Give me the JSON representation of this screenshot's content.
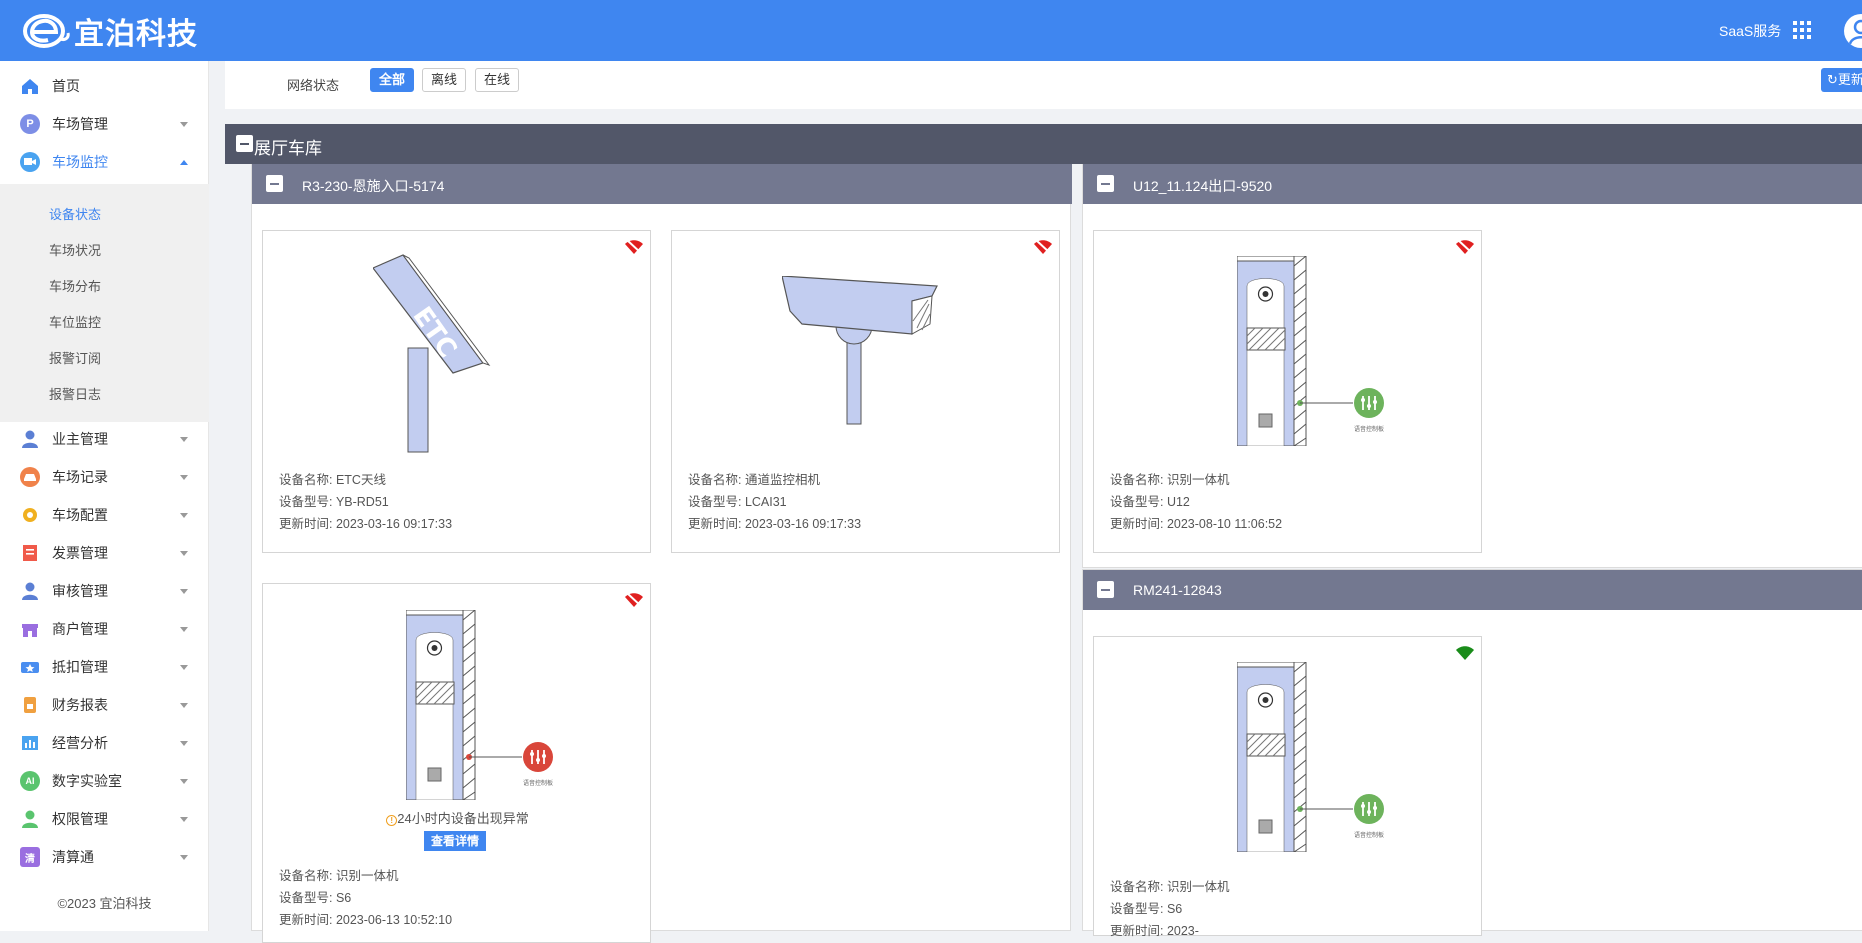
{
  "app": {
    "brand": "宜泊科技",
    "saas_label": "SaaS服务",
    "copyright": "©2023 宜泊科技"
  },
  "sidebar": {
    "items": [
      {
        "label": "首页",
        "icon": "home-icon",
        "color": "#3f86f0"
      },
      {
        "label": "车场管理",
        "icon": "parking-icon",
        "color": "#7d8ee6"
      },
      {
        "label": "车场监控",
        "icon": "monitor-icon",
        "color": "#4aa3f0"
      },
      {
        "label": "业主管理",
        "icon": "owner-icon",
        "color": "#5b7fd4"
      },
      {
        "label": "车场记录",
        "icon": "record-icon",
        "color": "#f0824a"
      },
      {
        "label": "车场配置",
        "icon": "config-icon",
        "color": "#f0b020"
      },
      {
        "label": "发票管理",
        "icon": "invoice-icon",
        "color": "#f05a4a"
      },
      {
        "label": "审核管理",
        "icon": "audit-icon",
        "color": "#5b7fd4"
      },
      {
        "label": "商户管理",
        "icon": "merchant-icon",
        "color": "#9a6ee0"
      },
      {
        "label": "抵扣管理",
        "icon": "deduct-icon",
        "color": "#4a8ef0"
      },
      {
        "label": "财务报表",
        "icon": "finance-icon",
        "color": "#f0a040"
      },
      {
        "label": "经营分析",
        "icon": "analysis-icon",
        "color": "#4aa3f0"
      },
      {
        "label": "数字实验室",
        "icon": "ai-lab-icon",
        "color": "#5ac46e"
      },
      {
        "label": "权限管理",
        "icon": "permission-icon",
        "color": "#5ac46e"
      },
      {
        "label": "清算通",
        "icon": "settle-icon",
        "color": "#9a6ee0"
      }
    ],
    "submenu": [
      "设备状态",
      "车场状况",
      "车场分布",
      "车位监控",
      "报警订阅",
      "报警日志"
    ],
    "lab_badge": "AI",
    "settle_badge": "清",
    "parking_badge": "P"
  },
  "filter": {
    "label": "网络状态",
    "options": [
      "全部",
      "离线",
      "在线"
    ],
    "refresh": "更新"
  },
  "group": {
    "title": "展厅车库"
  },
  "panels": [
    {
      "title": "R3-230-恩施入口-5174"
    },
    {
      "title": "U12_11.124出口-9520"
    },
    {
      "title": "RM241-12843"
    }
  ],
  "cards": [
    {
      "name": "设备名称: ETC天线",
      "model": "设备型号: YB-RD51",
      "time": "更新时间: 2023-03-16 09:17:33",
      "status": "offline",
      "etc_text": "ETC"
    },
    {
      "name": "设备名称: 通道监控相机",
      "model": "设备型号: LCAI31",
      "time": "更新时间: 2023-03-16 09:17:33",
      "status": "offline"
    },
    {
      "name": "设备名称: 识别一体机",
      "model": "设备型号: U12",
      "time": "更新时间: 2023-08-10 11:06:52",
      "status": "offline",
      "voice_label": "语音控制板"
    },
    {
      "name": "设备名称: 识别一体机",
      "model": "设备型号: S6",
      "time": "更新时间: 2023-06-13 10:52:10",
      "status": "offline",
      "warning": "24小时内设备出现异常",
      "detail": "查看详情",
      "voice_label": "语音控制板"
    },
    {
      "name": "设备名称: 识别一体机",
      "model": "设备型号: S6",
      "time": "更新时间: 2023-",
      "status": "online",
      "voice_label": "语音控制板"
    }
  ],
  "colors": {
    "offline": "#e02020",
    "online": "#1a8c1a",
    "accent": "#3f86f0",
    "device_fill": "#c2cdf0",
    "voice_ok": "#6db35c",
    "voice_err": "#d9463a"
  }
}
